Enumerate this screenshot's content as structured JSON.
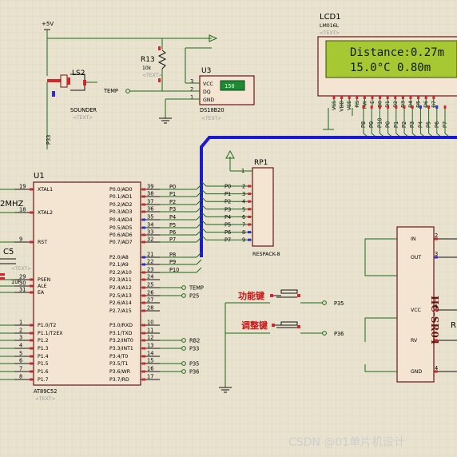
{
  "power": {
    "vcc_label": "+5V"
  },
  "buzzer": {
    "ref": "LS2",
    "value": "SOUNDER",
    "tag": "<TEXT>",
    "net": "P33"
  },
  "resistor_r13": {
    "ref": "R13",
    "value": "10k",
    "tag": "<TEXT>"
  },
  "sensor": {
    "ref": "U3",
    "part": "DS18B20",
    "tag": "<TEXT>",
    "display": "150",
    "pins": [
      {
        "num": "3",
        "name": "VCC"
      },
      {
        "num": "2",
        "name": "DQ"
      },
      {
        "num": "1",
        "name": "GND"
      }
    ],
    "net": "TEMP"
  },
  "lcd": {
    "ref": "LCD1",
    "part": "LM016L",
    "tag": "<TEXT>",
    "line1": "Distance:0.27m",
    "line2": "15.0°C  0.80m",
    "pins": [
      "VSS",
      "VDD",
      "VEE",
      "RS",
      "RW",
      "E",
      "D0",
      "D1",
      "D2",
      "D3",
      "D4",
      "D5",
      "D6",
      "D7"
    ],
    "nets": [
      "P8",
      "P9",
      "P10",
      "P0",
      "P1",
      "P2",
      "P3",
      "P4",
      "P5",
      "P6",
      "P7"
    ]
  },
  "mcu": {
    "ref": "U1",
    "part": "AT89C52",
    "tag": "<TEXT>",
    "crystal": "2MHZ",
    "left_pins": [
      {
        "num": "19",
        "name": "XTAL1"
      },
      {
        "num": "18",
        "name": "XTAL2"
      },
      {
        "num": "9",
        "name": "RST"
      },
      {
        "num": "29",
        "name": "PSEN"
      },
      {
        "num": "30",
        "name": "ALE"
      },
      {
        "num": "31",
        "name": "EA"
      },
      {
        "num": "1",
        "name": "P1.0/T2"
      },
      {
        "num": "2",
        "name": "P1.1/T2EX"
      },
      {
        "num": "3",
        "name": "P1.2"
      },
      {
        "num": "4",
        "name": "P1.3"
      },
      {
        "num": "5",
        "name": "P1.4"
      },
      {
        "num": "6",
        "name": "P1.5"
      },
      {
        "num": "7",
        "name": "P1.6"
      },
      {
        "num": "8",
        "name": "P1.7"
      }
    ],
    "right_pins": [
      {
        "num": "39",
        "name": "P0.0/AD0",
        "net": "P0"
      },
      {
        "num": "38",
        "name": "P0.1/AD1",
        "net": "P1"
      },
      {
        "num": "37",
        "name": "P0.2/AD2",
        "net": "P2"
      },
      {
        "num": "36",
        "name": "P0.3/AD3",
        "net": "P3"
      },
      {
        "num": "35",
        "name": "P0.4/AD4",
        "net": "P4"
      },
      {
        "num": "34",
        "name": "P0.5/AD5",
        "net": "P5"
      },
      {
        "num": "33",
        "name": "P0.6/AD6",
        "net": "P6"
      },
      {
        "num": "32",
        "name": "P0.7/AD7",
        "net": "P7"
      },
      {
        "num": "21",
        "name": "P2.0/A8",
        "net": "P8"
      },
      {
        "num": "22",
        "name": "P2.1/A9",
        "net": "P9"
      },
      {
        "num": "23",
        "name": "P2.2/A10",
        "net": "P10"
      },
      {
        "num": "24",
        "name": "P2.3/A11",
        "net": ""
      },
      {
        "num": "25",
        "name": "P2.4/A12",
        "net": "TEMP"
      },
      {
        "num": "26",
        "name": "P2.5/A13",
        "net": "P25"
      },
      {
        "num": "27",
        "name": "P2.6/A14",
        "net": ""
      },
      {
        "num": "28",
        "name": "P2.7/A15",
        "net": ""
      },
      {
        "num": "10",
        "name": "P3.0/RXD",
        "net": ""
      },
      {
        "num": "11",
        "name": "P3.1/TXD",
        "net": ""
      },
      {
        "num": "12",
        "name": "P3.2/INT0",
        "net": "RB2"
      },
      {
        "num": "13",
        "name": "P3.3/INT1",
        "net": "P33"
      },
      {
        "num": "14",
        "name": "P3.4/T0",
        "net": ""
      },
      {
        "num": "15",
        "name": "P3.5/T1",
        "net": "P35"
      },
      {
        "num": "16",
        "name": "P3.6/WR",
        "net": "P36"
      },
      {
        "num": "17",
        "name": "P3.7/RD",
        "net": ""
      }
    ]
  },
  "capacitor": {
    "ref": "C5",
    "value": "1uF",
    "tag": "<TEXT>"
  },
  "rp1": {
    "ref": "RP1",
    "part": "RESPACK-8",
    "common": "1",
    "pins": [
      {
        "num": "2",
        "net": "P0"
      },
      {
        "num": "3",
        "net": "P1"
      },
      {
        "num": "4",
        "net": "P2"
      },
      {
        "num": "5",
        "net": "P3"
      },
      {
        "num": "6",
        "net": "P4"
      },
      {
        "num": "7",
        "net": "P5"
      },
      {
        "num": "8",
        "net": "P6"
      },
      {
        "num": "9",
        "net": "P7"
      }
    ]
  },
  "buttons": [
    {
      "label": "功能键",
      "net": "P35"
    },
    {
      "label": "调整键",
      "net": "P36"
    }
  ],
  "ultrasonic": {
    "part": "HC-SR04",
    "pins": [
      {
        "num": "2",
        "name": "IN"
      },
      {
        "num": "3",
        "name": "OUT"
      },
      {
        "num": "1",
        "name": "VCC"
      },
      {
        "num": "",
        "name": "RV"
      },
      {
        "num": "4",
        "name": "GND"
      }
    ]
  },
  "watermark": "CSDN @01单片机设计",
  "colors": {
    "background": "#e8e2cf",
    "wire": "#1a6b1a",
    "chip_fill": "#f3e5d1",
    "chip_border": "#6a1414",
    "bus": "#1a1ad2",
    "lcd_screen": "#a6c832"
  }
}
